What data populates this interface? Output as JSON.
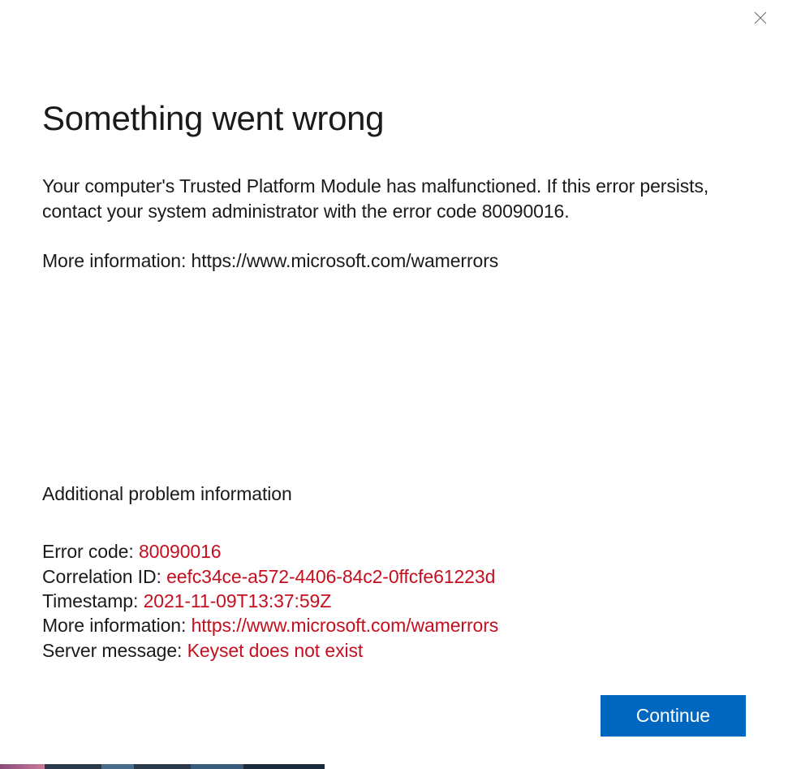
{
  "heading": "Something went wrong",
  "paragraph1": "Your computer's Trusted Platform Module has malfunctioned. If this error persists, contact your system administrator with the error code 80090016.",
  "paragraph2": "More information: https://www.microsoft.com/wamerrors",
  "additional_heading": "Additional problem information",
  "details": {
    "error_code": {
      "label": "Error code: ",
      "value": "80090016"
    },
    "correlation_id": {
      "label": "Correlation ID: ",
      "value": "eefc34ce-a572-4406-84c2-0ffcfe61223d"
    },
    "timestamp": {
      "label": "Timestamp: ",
      "value": "2021-11-09T13:37:59Z"
    },
    "more_info": {
      "label": "More information: ",
      "value": "https://www.microsoft.com/wamerrors"
    },
    "server_message": {
      "label": "Server message: ",
      "value": "Keyset does not exist"
    }
  },
  "continue_label": "Continue"
}
